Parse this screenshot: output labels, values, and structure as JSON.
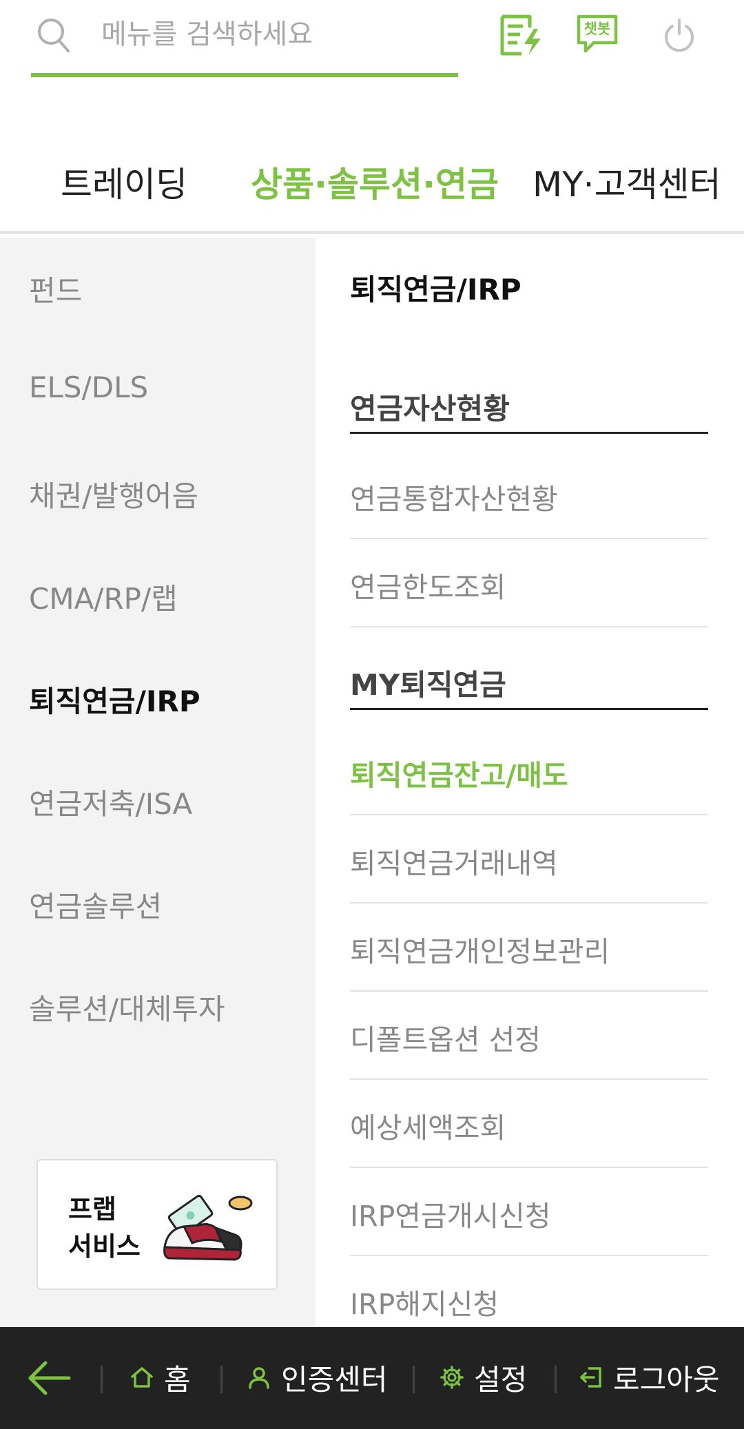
{
  "search": {
    "placeholder": "메뉴를 검색하세요"
  },
  "top_icons": {
    "chatbot_label": "챗봇"
  },
  "tabs": [
    {
      "label": "트레이딩"
    },
    {
      "label": "상품·솔루션·연금",
      "active": true
    },
    {
      "label": "MY·고객센터"
    }
  ],
  "left_menu": {
    "items": [
      {
        "label": "펀드"
      },
      {
        "label": "ELS/DLS"
      },
      {
        "label": "채권/발행어음"
      },
      {
        "label": "CMA/RP/랩"
      },
      {
        "label": "퇴직연금/IRP",
        "active": true
      },
      {
        "label": "연금저축/ISA"
      },
      {
        "label": "연금솔루션"
      },
      {
        "label": "솔루션/대체투자"
      }
    ],
    "promo": {
      "line1": "프랩",
      "line2": "서비스"
    }
  },
  "right_menu": {
    "title": "퇴직연금/IRP",
    "sections": [
      {
        "heading": "연금자산현황",
        "items": [
          "연금통합자산현황",
          "연금한도조회"
        ]
      },
      {
        "heading": "MY퇴직연금",
        "items": [
          "퇴직연금잔고/매도",
          "퇴직연금거래내역",
          "퇴직연금개인정보관리",
          "디폴트옵션 선정",
          "예상세액조회",
          "IRP연금개시신청",
          "IRP해지신청"
        ],
        "active_item": "퇴직연금잔고/매도"
      }
    ]
  },
  "bottom_nav": {
    "home": "홈",
    "auth": "인증센터",
    "settings": "설정",
    "logout": "로그아웃"
  },
  "colors": {
    "accent": "#7dc242",
    "dark_bar": "#222222",
    "left_bg": "#f3f3f3"
  }
}
